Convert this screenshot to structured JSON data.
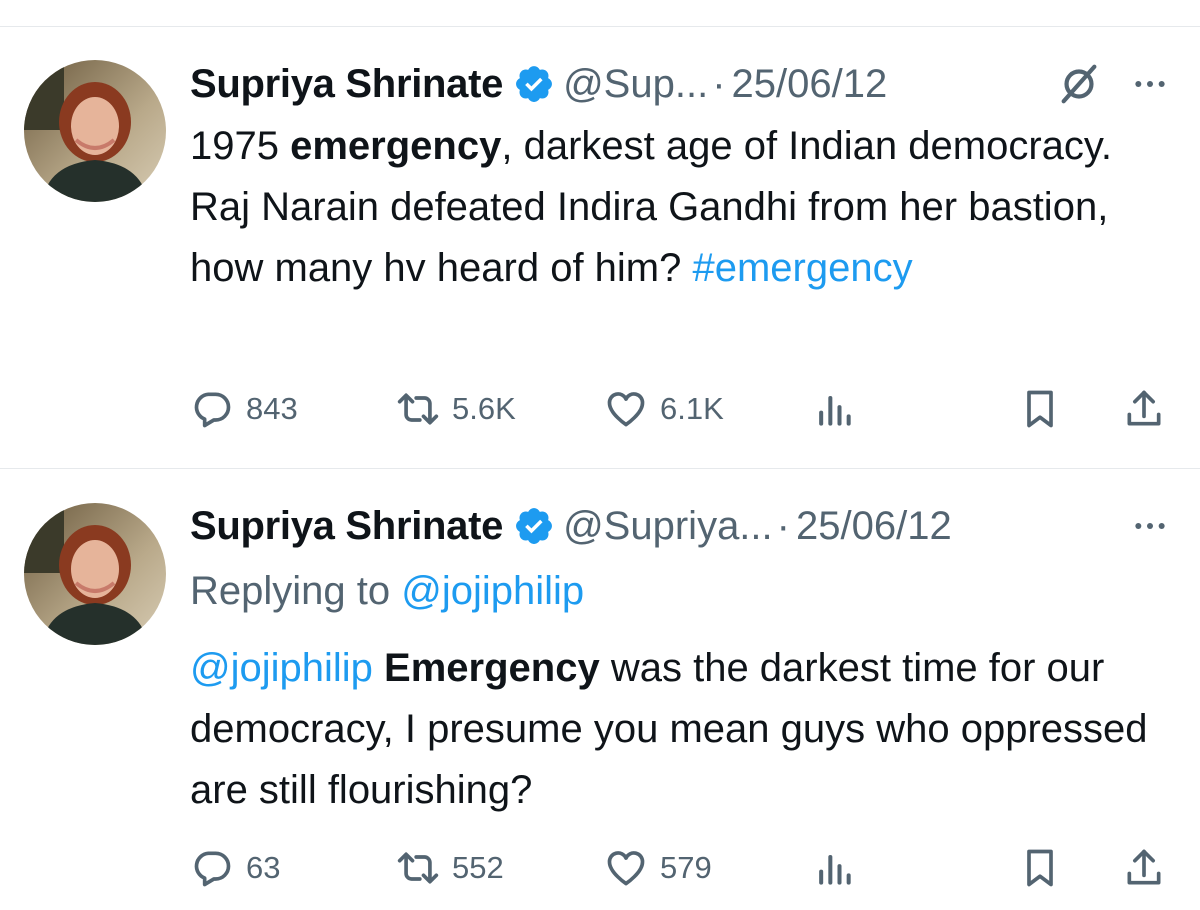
{
  "tweets": [
    {
      "author": {
        "name": "Supriya Shrinate",
        "handle": "@Sup...",
        "verified": true
      },
      "dot": "·",
      "date": "25/06/12",
      "header_icons": [
        "grok-icon",
        "more-icon"
      ],
      "body": {
        "t1": "1975 ",
        "b1": "emergency",
        "t2": ", darkest age of Indian democracy. Raj Narain defeated Indira Gandhi from her bastion, how many hv heard of him? ",
        "hashtag": "#emergency"
      },
      "stats": {
        "replies": "843",
        "reposts": "5.6K",
        "likes": "6.1K"
      }
    },
    {
      "author": {
        "name": "Supriya Shrinate",
        "handle": "@Supriya...",
        "verified": true
      },
      "dot": "·",
      "date": "25/06/12",
      "header_icons": [
        "more-icon"
      ],
      "replying_to": {
        "prefix": "Replying to ",
        "handle": "@jojiphilip"
      },
      "body": {
        "mention": "@jojiphilip",
        "b1": "Emergency",
        "t1": " was the darkest time for our democracy, I presume you mean guys who oppressed are still flourishing?"
      },
      "stats": {
        "replies": "63",
        "reposts": "552",
        "likes": "579"
      }
    }
  ],
  "icons": {
    "reply": "reply-icon",
    "repost": "repost-icon",
    "like": "heart-icon",
    "views": "analytics-icon",
    "bookmark": "bookmark-icon",
    "share": "share-icon"
  },
  "colors": {
    "text": "#0f1419",
    "secondary": "#536471",
    "link": "#1d9bf0",
    "verified": "#1d9bf0",
    "divider": "#e6e9ec"
  }
}
